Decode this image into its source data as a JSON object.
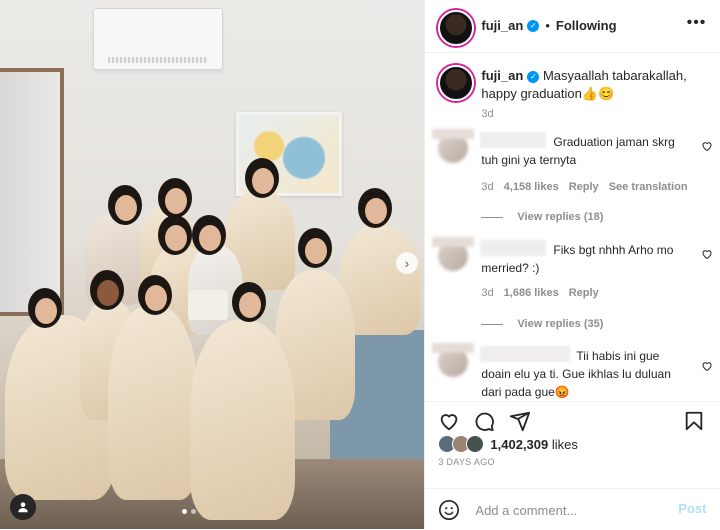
{
  "header": {
    "username": "fuji_an",
    "follow_status": "Following",
    "separator": "•",
    "more": "•••"
  },
  "caption": {
    "username": "fuji_an",
    "text": "Masyaallah tabarakallah, happy graduation👍😊",
    "time": "3d"
  },
  "comments": [
    {
      "text": "Graduation jaman skrg tuh gini ya ternyta",
      "time": "3d",
      "likes": "4,158 likes",
      "reply": "Reply",
      "translate": "See translation",
      "view_replies": "View replies (18)"
    },
    {
      "text": "Fiks bgt nhhh Arho mo merried? :)",
      "time": "3d",
      "likes": "1,686 likes",
      "reply": "Reply",
      "view_replies": "View replies (35)"
    },
    {
      "text": "Tii habis ini gue doain elu ya ti. Gue ikhlas lu duluan dari pada gue😡"
    }
  ],
  "likes": {
    "count": "1,402,309",
    "suffix": " likes"
  },
  "post_date": "3 DAYS AGO",
  "add_comment": {
    "placeholder": "Add a comment...",
    "post_label": "Post"
  },
  "icons": {
    "verified": "verified-badge-icon",
    "heart": "heart-icon",
    "comment": "comment-icon",
    "share": "share-icon",
    "save": "bookmark-icon",
    "emoji": "emoji-icon",
    "next": "chevron-right-icon",
    "tag": "user-tag-icon"
  },
  "colors": {
    "verified": "#0095f6",
    "post_button": "#b2dffc",
    "muted_text": "#8e8e8e"
  }
}
